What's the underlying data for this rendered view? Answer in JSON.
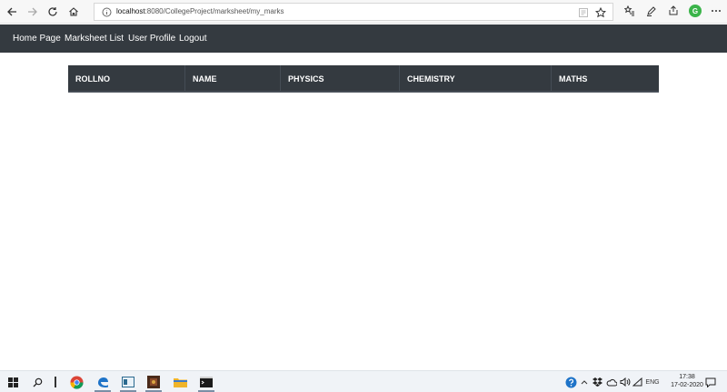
{
  "browser": {
    "url_host": "localhost",
    "url_rest": ":8080/CollegeProject/marksheet/my_marks",
    "profile_initial": "G"
  },
  "navbar": {
    "items": [
      "Home Page",
      "Marksheet List",
      "User Profile",
      "Logout"
    ]
  },
  "table": {
    "headers": [
      "ROLLNO",
      "NAME",
      "PHYSICS",
      "CHEMISTRY",
      "MATHS"
    ],
    "rows": []
  },
  "taskbar": {
    "language": "ENG",
    "time": "17:38",
    "date": "17-02-2020"
  },
  "colors": {
    "navbar_bg": "#343a40",
    "table_header_bg": "#343a40",
    "profile_accent": "#3bb44a"
  }
}
